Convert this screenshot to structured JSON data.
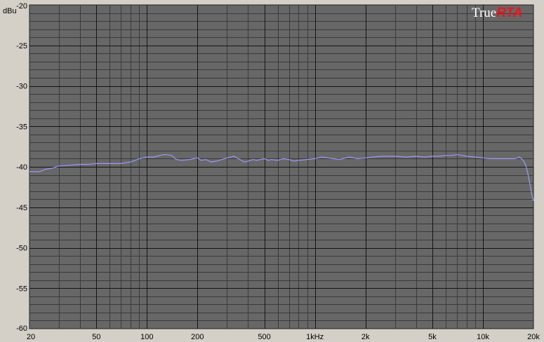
{
  "chart_data": {
    "type": "line",
    "title": "",
    "xlabel": "",
    "ylabel": "dBu",
    "xscale": "log",
    "xlim": [
      20,
      20000
    ],
    "ylim": [
      -60,
      -20
    ],
    "grid": true,
    "background_color": "#676767",
    "line_color": "#9a9aff",
    "x_tick_values": [
      20,
      50,
      100,
      200,
      500,
      1000,
      2000,
      5000,
      10000,
      20000
    ],
    "x_tick_labels": [
      "20",
      "50",
      "100",
      "200",
      "500",
      "1kHz",
      "2k",
      "5k",
      "10k",
      "20k"
    ],
    "y_tick_values": [
      -20,
      -25,
      -30,
      -35,
      -40,
      -45,
      -50,
      -55,
      -60
    ],
    "y_tick_labels": [
      "-20",
      "-25",
      "-30",
      "-35",
      "-40",
      "-45",
      "-50",
      "-55",
      "-60"
    ],
    "series": [
      {
        "x": [
          20,
          23,
          25,
          27,
          30,
          35,
          40,
          45,
          50,
          60,
          70,
          75,
          80,
          85,
          90,
          95,
          100,
          110,
          115,
          120,
          125,
          130,
          140,
          150,
          160,
          180,
          200,
          210,
          225,
          240,
          260,
          280,
          300,
          330,
          350,
          380,
          400,
          430,
          450,
          500,
          530,
          550,
          600,
          650,
          700,
          750,
          800,
          900,
          1000,
          1100,
          1200,
          1400,
          1600,
          1800,
          2000,
          2200,
          2500,
          3000,
          3500,
          4000,
          4500,
          5000,
          5500,
          6000,
          6500,
          7000,
          7500,
          8000,
          9000,
          10000,
          11000,
          12000,
          13000,
          14000,
          15000,
          15500,
          16000,
          16500,
          17000,
          17500,
          18000,
          18500,
          19000,
          19500,
          20000
        ],
        "values": [
          -40.6,
          -40.6,
          -40.3,
          -40.2,
          -39.9,
          -39.8,
          -39.7,
          -39.7,
          -39.6,
          -39.6,
          -39.6,
          -39.5,
          -39.4,
          -39.2,
          -39.0,
          -38.9,
          -38.8,
          -38.8,
          -38.7,
          -38.6,
          -38.5,
          -38.5,
          -38.6,
          -39.1,
          -39.2,
          -39.1,
          -38.9,
          -39.2,
          -39.1,
          -39.4,
          -39.3,
          -39.1,
          -38.9,
          -38.7,
          -39.0,
          -39.4,
          -39.3,
          -39.1,
          -39.2,
          -39.0,
          -39.2,
          -39.1,
          -39.2,
          -39.0,
          -39.1,
          -39.3,
          -39.2,
          -39.1,
          -39.0,
          -38.8,
          -38.9,
          -39.1,
          -38.8,
          -39.0,
          -38.9,
          -38.8,
          -38.7,
          -38.7,
          -38.8,
          -38.7,
          -38.8,
          -38.7,
          -38.7,
          -38.6,
          -38.6,
          -38.5,
          -38.6,
          -38.7,
          -38.8,
          -38.9,
          -39.0,
          -39.0,
          -39.0,
          -39.0,
          -39.0,
          -39.0,
          -38.9,
          -38.8,
          -39.0,
          -39.3,
          -39.8,
          -40.8,
          -42.0,
          -43.3,
          -44.2
        ]
      }
    ]
  },
  "branding": {
    "true_label": "True",
    "rta_label": "RTA"
  }
}
